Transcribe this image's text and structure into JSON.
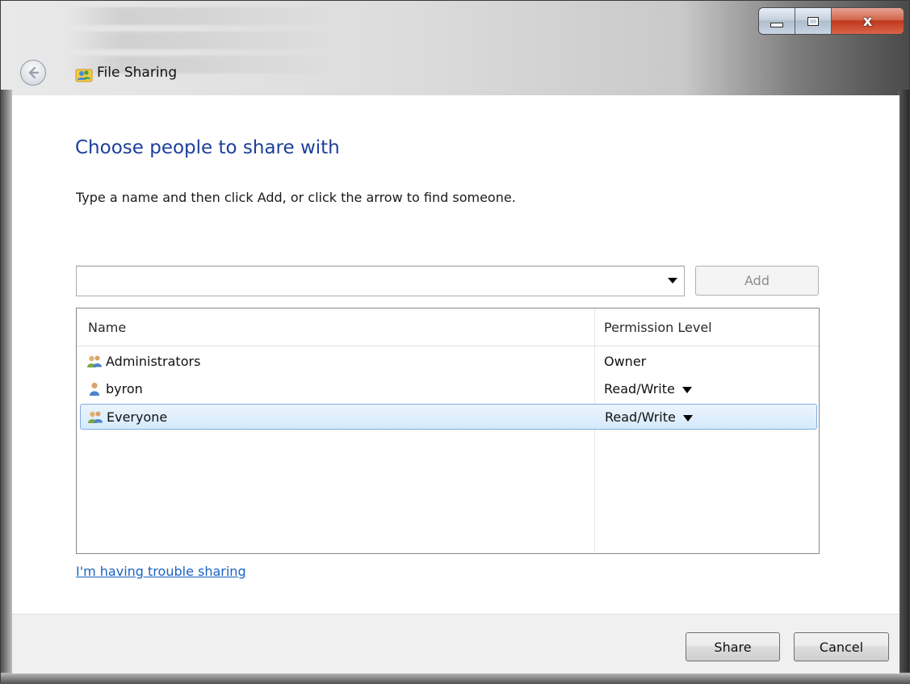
{
  "window": {
    "title": "File Sharing",
    "close_label": "x"
  },
  "content": {
    "heading": "Choose people to share with",
    "instruction": "Type a name and then click Add, or click the arrow to find someone.",
    "combo": {
      "value": ""
    },
    "add_label": "Add"
  },
  "list": {
    "columns": [
      "Name",
      "Permission Level"
    ],
    "rows": [
      {
        "name": "Administrators",
        "permission": "Owner",
        "icon": "group-icon",
        "selected": false
      },
      {
        "name": "byron",
        "permission": "Read/Write",
        "icon": "user-icon",
        "selected": false
      },
      {
        "name": "Everyone",
        "permission": "Read/Write",
        "icon": "group-icon",
        "selected": true
      }
    ]
  },
  "link": "I'm having trouble sharing",
  "footer": {
    "share_label": "Share",
    "cancel_label": "Cancel"
  }
}
